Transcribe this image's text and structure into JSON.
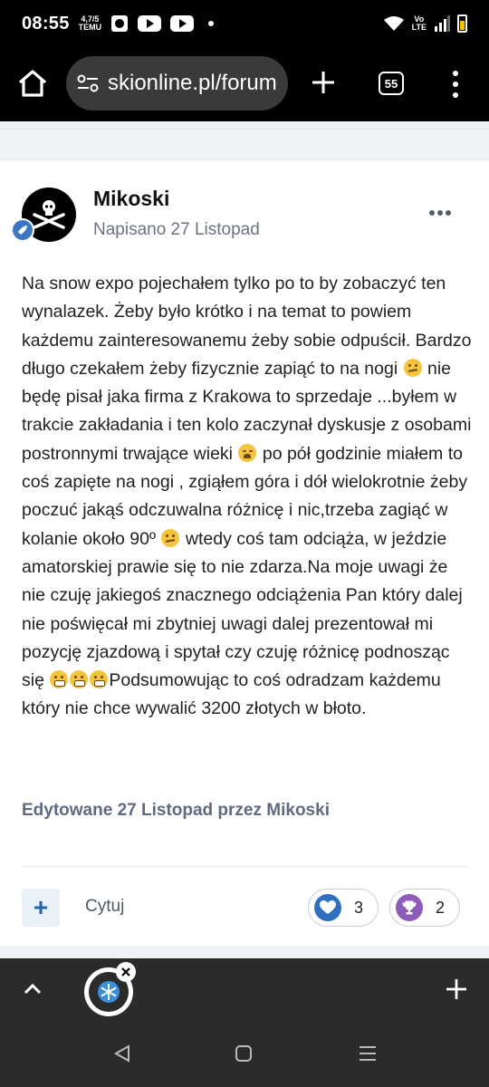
{
  "status": {
    "time": "08:55",
    "notif_temu_top": "4,7/5",
    "notif_temu_bottom": "TEMU",
    "network_top": "Vo",
    "network_bottom": "LTE"
  },
  "browser": {
    "url": "skionline.pl/forum",
    "tab_count": "55"
  },
  "post": {
    "author": "Mikoski",
    "posted": "Napisano 27 Listopad",
    "paragraph_1": "Na snow expo pojechałem tylko po to by zobaczyć ten wynalazek. Żeby było krótko i na temat to powiem każdemu zainteresowanemu żeby sobie odpuścił. Bardzo długo czekałem żeby fizycznie zapiąć to na nogi",
    "paragraph_2": "nie będę pisał jaka firma z Krakowa to sprzedaje ...byłem w trakcie zakładania i ten kolo zaczynał dyskusje z osobami postronnymi trwające wieki",
    "paragraph_3": "po pół godzinie miałem to coś zapięte na nogi , zgiąłem góra i dół  wielokrotnie żeby poczuć jakąś odczuwalna różnicę i nic,trzeba zagiąć w kolanie około 90º",
    "paragraph_4": " wtedy coś tam odciąża, w jeździe amatorskiej prawie się to nie zdarza.Na moje uwagi że nie czuję jakiegoś znacznego odciążenia Pan który dalej nie poświęcał mi zbytniej uwagi dalej prezentował mi pozycję zjazdową i spytał czy czuję różnicę podnosząc się",
    "paragraph_5": "Podsumowując to coś odradzam każdemu który nie chce wywalić 3200 złotych w błoto.",
    "edited": "Edytowane 27 Listopad przez Mikoski",
    "multiquote_label": "+",
    "quote_label": "Cytuj",
    "reactions": {
      "like_count": "3",
      "trophy_count": "2"
    }
  },
  "colors": {
    "accent": "#3b77c2",
    "like": "#2f6fbf",
    "trophy": "#8e5bb8"
  }
}
